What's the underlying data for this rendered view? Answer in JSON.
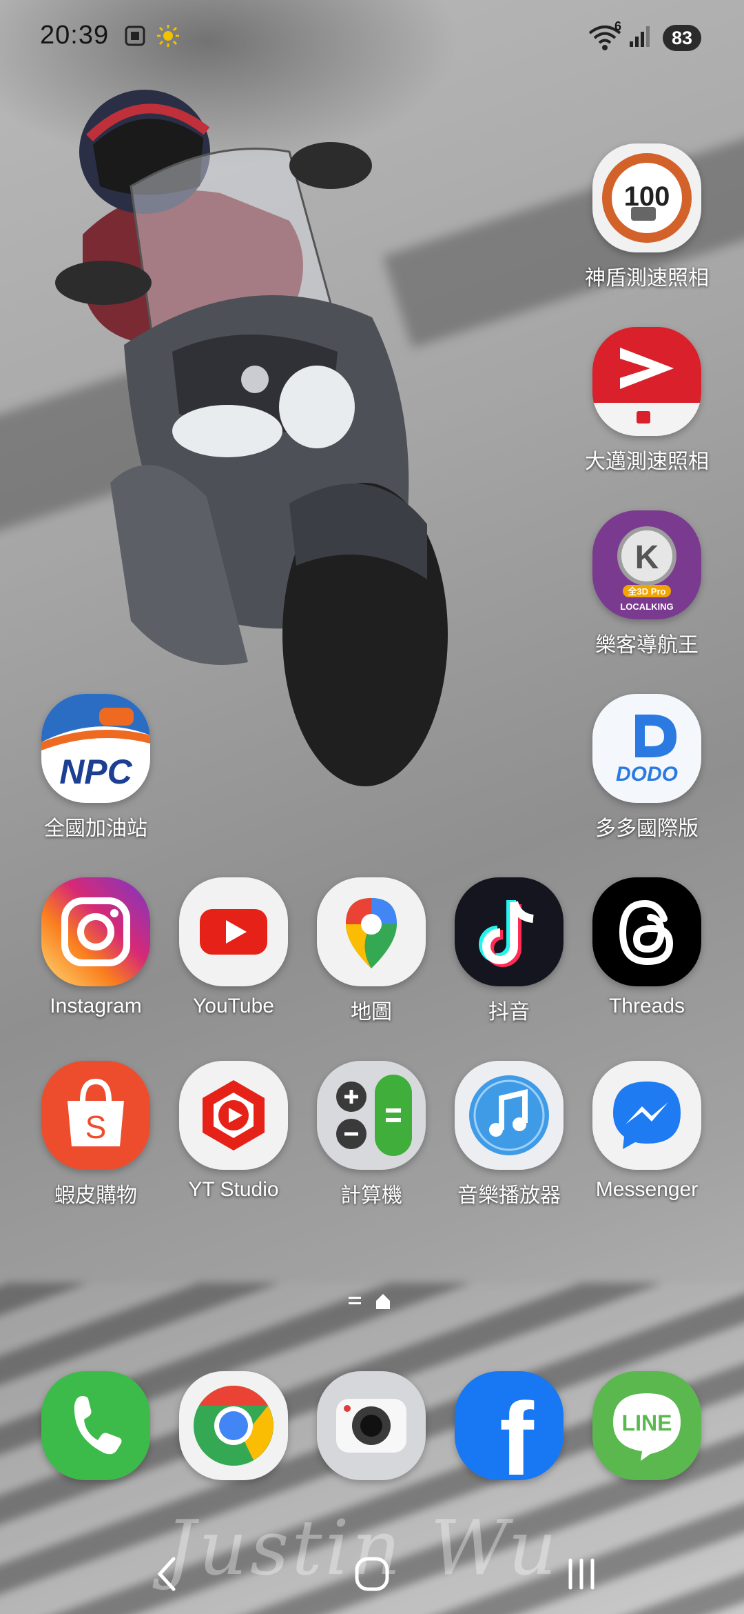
{
  "status_bar": {
    "time": "20:39",
    "wifi_badge": "6",
    "battery": "83"
  },
  "home": {
    "apps": [
      {
        "id": "speedcam-shield",
        "label": "神盾測速照相"
      },
      {
        "id": "speedcam-dawan",
        "label": "大邁測速照相"
      },
      {
        "id": "localking",
        "label": "樂客導航王",
        "icon_text": "K",
        "icon_sub": "全3D Pro",
        "icon_brand": "LOCALKING"
      },
      {
        "id": "npc",
        "label": "全國加油站",
        "icon_text": "NPC"
      },
      {
        "id": "dodo",
        "label": "多多國際版",
        "icon_text": "DODO"
      },
      {
        "id": "instagram",
        "label": "Instagram"
      },
      {
        "id": "youtube",
        "label": "YouTube"
      },
      {
        "id": "maps",
        "label": "地圖"
      },
      {
        "id": "douyin",
        "label": "抖音"
      },
      {
        "id": "threads",
        "label": "Threads"
      },
      {
        "id": "shopee",
        "label": "蝦皮購物",
        "icon_text": "S"
      },
      {
        "id": "yt-studio",
        "label": "YT Studio"
      },
      {
        "id": "calculator",
        "label": "計算機"
      },
      {
        "id": "music",
        "label": "音樂播放器"
      },
      {
        "id": "messenger",
        "label": "Messenger"
      }
    ],
    "dock": [
      {
        "id": "phone",
        "label": "Phone"
      },
      {
        "id": "chrome",
        "label": "Chrome"
      },
      {
        "id": "camera",
        "label": "Camera"
      },
      {
        "id": "facebook",
        "label": "Facebook",
        "icon_text": "f"
      },
      {
        "id": "line",
        "label": "LINE",
        "icon_text": "LINE"
      }
    ],
    "speed_sign_text": "100",
    "watermark": "Justin Wu"
  },
  "icons": {
    "status": [
      "screenshot-icon",
      "brightness-icon",
      "wifi-icon",
      "signal-icon",
      "battery-icon"
    ],
    "nav": [
      "back-icon",
      "home-icon",
      "recents-icon"
    ]
  },
  "colors": {
    "instagram": "#d6249f",
    "youtube": "#e62117",
    "shopee": "#ee4d2d",
    "facebook": "#1877f2",
    "line": "#06c755",
    "phone": "#3dbb4a",
    "messenger": "#1e7bf2"
  }
}
